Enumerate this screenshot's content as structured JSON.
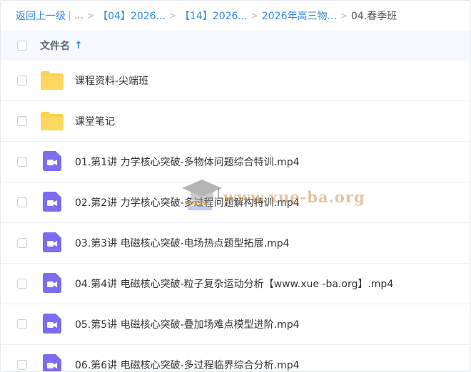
{
  "breadcrumb": {
    "back_label": "返回上一级",
    "pipe": "|",
    "dots": "...",
    "separator": ">",
    "items": [
      "【04】2026...",
      "【14】2026...",
      "2026年高三物...",
      "04.春季班"
    ]
  },
  "header": {
    "column_name": "文件名",
    "sort_indicator": "↑"
  },
  "files": [
    {
      "type": "folder",
      "name": "课程资料-尖端班"
    },
    {
      "type": "folder",
      "name": "课堂笔记"
    },
    {
      "type": "video",
      "name": "01.第1讲 力学核心突破-多物体问题综合特训.mp4"
    },
    {
      "type": "video",
      "name": "02.第2讲 力学核心突破-多过程问题解构特训.mp4"
    },
    {
      "type": "video",
      "name": "03.第3讲 电磁核心突破-电场热点题型拓展.mp4"
    },
    {
      "type": "video",
      "name": "04.第4讲 电磁核心突破-粒子复杂运动分析【www.xue -ba.org】.mp4"
    },
    {
      "type": "video",
      "name": "05.第5讲 电磁核心突破-叠加场难点模型进阶.mp4"
    },
    {
      "type": "video",
      "name": "06.第6讲 电磁核心突破-多过程临界综合分析.mp4"
    }
  ],
  "watermark": {
    "text": "www.xue-ba.org"
  },
  "colors": {
    "link": "#2f88e8",
    "folder": "#fbd249",
    "video": "#7b6cf0",
    "header_bg": "#f5f8fd"
  }
}
